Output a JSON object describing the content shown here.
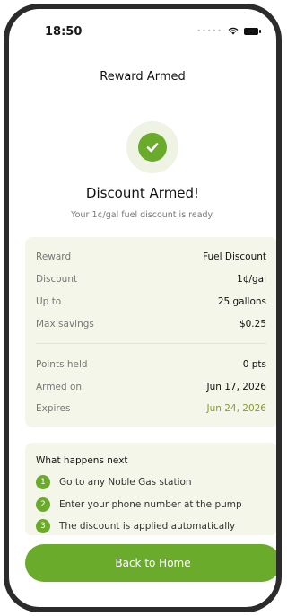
{
  "status_bar": {
    "time": "18:50"
  },
  "header": {
    "title": "Reward Armed"
  },
  "hero": {
    "icon": "check-icon",
    "headline": "Discount Armed!",
    "subtitle": "Your 1¢/gal fuel discount is ready."
  },
  "details": {
    "rows": [
      {
        "label": "Reward",
        "value": "Fuel Discount"
      },
      {
        "label": "Discount",
        "value": "1¢/gal"
      },
      {
        "label": "Up to",
        "value": "25 gallons"
      },
      {
        "label": "Max savings",
        "value": "$0.25"
      },
      {
        "label": "Points held",
        "value": "0 pts"
      },
      {
        "label": "Armed on",
        "value": "Jun 17, 2026"
      },
      {
        "label": "Expires",
        "value": "Jun 24, 2026"
      }
    ]
  },
  "next_steps": {
    "title": "What happens next",
    "steps": [
      {
        "num": "1",
        "text": "Go to any Noble Gas station"
      },
      {
        "num": "2",
        "text": "Enter your phone number at the pump"
      },
      {
        "num": "3",
        "text": "The discount is applied automatically"
      }
    ]
  },
  "actions": {
    "back_home": "Back to Home"
  },
  "colors": {
    "accent": "#6bab2c",
    "card_bg": "#f4f6ea",
    "expires": "#8a9a2a"
  }
}
